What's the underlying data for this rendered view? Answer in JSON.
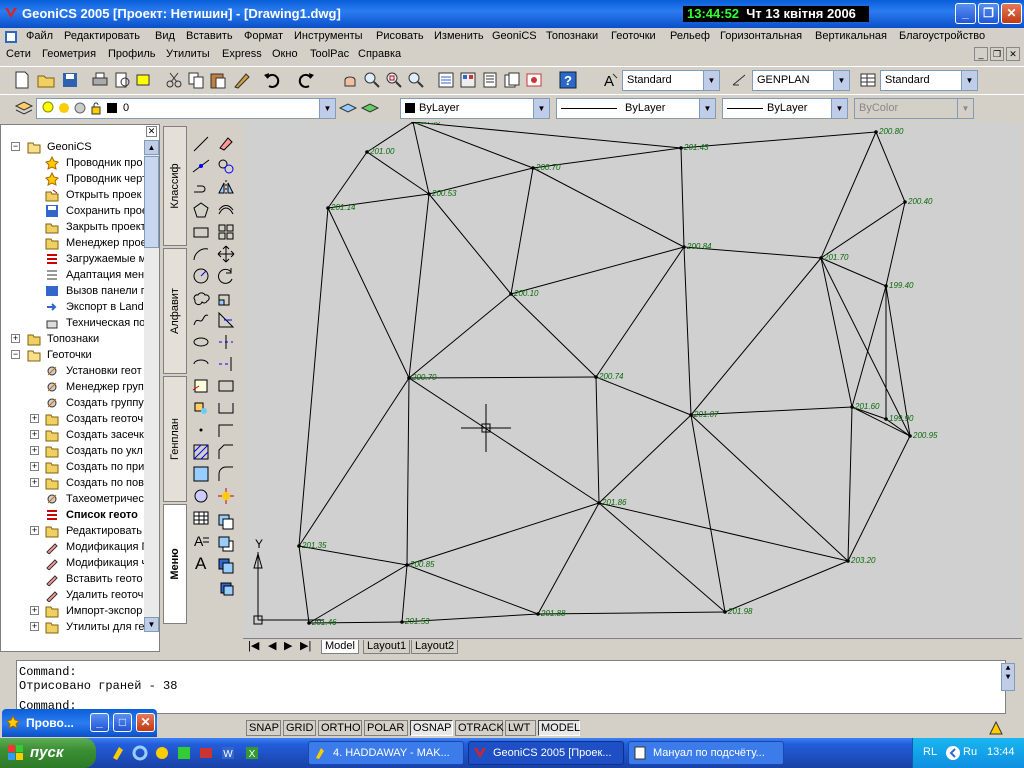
{
  "window": {
    "title": "GeoniCS 2005 [Проект: Нетишин] - [Drawing1.dwg]",
    "clock_time": "13:44:52",
    "clock_date": "Чт 13 квітня 2006",
    "btn_min": "_",
    "btn_max": "❐",
    "btn_close": "✕"
  },
  "menu1": [
    "Файл",
    "Редактировать",
    "Вид",
    "Вставить",
    "Формат",
    "Инструменты",
    "Рисовать",
    "Изменить",
    "GeoniCS",
    "Топознаки",
    "Геоточки",
    "Рельеф",
    "Горизонтальная",
    "Вертикальная",
    "Благоустройство"
  ],
  "menu2": [
    "Сети",
    "Геометрия",
    "Профиль",
    "Утилиты",
    "Express",
    "Окно",
    "ToolPac",
    "Справка"
  ],
  "mdi": {
    "min": "_",
    "restore": "❐",
    "close": "✕"
  },
  "toolbar": {
    "text_style": "Standard",
    "dim_style": "GENPLAN",
    "table_style": "Standard",
    "layer": "0",
    "color": "ByLayer",
    "linetype": "ByLayer",
    "lineweight": "ByLayer",
    "plotstyle": "ByColor"
  },
  "tree": [
    {
      "label": "GeoniCS",
      "level": 0,
      "exp": "−",
      "icon": "folder-open"
    },
    {
      "label": "Проводник про",
      "level": 2,
      "icon": "star"
    },
    {
      "label": "Проводник черт",
      "level": 2,
      "icon": "star"
    },
    {
      "label": "Открыть проек",
      "level": 2,
      "icon": "open"
    },
    {
      "label": "Сохранить прое",
      "level": 2,
      "icon": "save"
    },
    {
      "label": "Закрыть проект",
      "level": 2,
      "icon": "close-doc"
    },
    {
      "label": "Менеджер прое",
      "level": 2,
      "icon": "folder"
    },
    {
      "label": "Загружаемые м",
      "level": 2,
      "icon": "list"
    },
    {
      "label": "Адаптация мен",
      "level": 2,
      "icon": "menu"
    },
    {
      "label": "Вызов панели г",
      "level": 2,
      "icon": "panel"
    },
    {
      "label": "Экспорт в Land",
      "level": 2,
      "icon": "export"
    },
    {
      "label": "Техническая по",
      "level": 2,
      "icon": "phone"
    },
    {
      "label": "Топознаки",
      "level": 0,
      "exp": "+",
      "icon": "folder"
    },
    {
      "label": "Геоточки",
      "level": 0,
      "exp": "−",
      "icon": "folder-open"
    },
    {
      "label": "Установки геот",
      "level": 2,
      "icon": "settings"
    },
    {
      "label": "Менеджер груп",
      "level": 2,
      "icon": "settings"
    },
    {
      "label": "Создать группу",
      "level": 2,
      "icon": "settings"
    },
    {
      "label": "Создать геоточ",
      "level": 1,
      "exp": "+",
      "icon": "folder"
    },
    {
      "label": "Создать засечк",
      "level": 1,
      "exp": "+",
      "icon": "folder"
    },
    {
      "label": "Создать по укл",
      "level": 1,
      "exp": "+",
      "icon": "folder"
    },
    {
      "label": "Создать по при",
      "level": 1,
      "exp": "+",
      "icon": "folder"
    },
    {
      "label": "Создать по пов",
      "level": 1,
      "exp": "+",
      "icon": "folder"
    },
    {
      "label": "Тахеометричес",
      "level": 2,
      "icon": "settings"
    },
    {
      "label": "Список геото",
      "level": 2,
      "icon": "list",
      "bold": true
    },
    {
      "label": "Редактировать",
      "level": 1,
      "exp": "+",
      "icon": "folder"
    },
    {
      "label": "Модификация Г",
      "level": 2,
      "icon": "edit"
    },
    {
      "label": "Модификация ч",
      "level": 2,
      "icon": "edit"
    },
    {
      "label": "Вставить геото",
      "level": 2,
      "icon": "edit"
    },
    {
      "label": "Удалить геоточ",
      "level": 2,
      "icon": "edit"
    },
    {
      "label": "Импорт-экспор",
      "level": 1,
      "exp": "+",
      "icon": "folder"
    },
    {
      "label": "Утилиты для ге",
      "level": 1,
      "exp": "+",
      "icon": "folder"
    }
  ],
  "vtabs": [
    "Классиф",
    "Алфавит",
    "Генплан",
    "Меню"
  ],
  "points": [
    {
      "label": "201.00",
      "x": 0
    },
    {
      "label": "201.43",
      "x": 1
    },
    {
      "label": "200.80",
      "x": 2
    },
    {
      "label": "200.70",
      "x": 3
    },
    {
      "label": "200.53",
      "x": 4
    },
    {
      "label": "201.14",
      "x": 5
    },
    {
      "label": "200.40",
      "x": 6
    },
    {
      "label": "200.84",
      "x": 7
    },
    {
      "label": "201.70",
      "x": 8
    },
    {
      "label": "199.40",
      "x": 9
    },
    {
      "label": "200.10",
      "x": 10
    },
    {
      "label": "200.70",
      "x": 11
    },
    {
      "label": "200.74",
      "x": 12
    },
    {
      "label": "201.07",
      "x": 13
    },
    {
      "label": "201.60",
      "x": 14
    },
    {
      "label": "199.90",
      "x": 15
    },
    {
      "label": "200.95",
      "x": 16
    },
    {
      "label": "201.86",
      "x": 17
    },
    {
      "label": "201.35",
      "x": 18
    },
    {
      "label": "200.85",
      "x": 19
    },
    {
      "label": "203.20",
      "x": 20
    },
    {
      "label": "201.46",
      "x": 21
    },
    {
      "label": "201.53",
      "x": 22
    },
    {
      "label": "201.88",
      "x": 23
    },
    {
      "label": "201.98",
      "x": 24
    },
    {
      "label": "200.90",
      "x": 25
    }
  ],
  "ucs": {
    "y_label": "Y"
  },
  "layout_tabs": [
    "Model",
    "Layout1",
    "Layout2"
  ],
  "command": {
    "line1": "Command:",
    "line2": "Отрисовано граней - 38",
    "line3": "Command:"
  },
  "status_buttons": [
    "SNAP",
    "GRID",
    "ORTHO",
    "POLAR",
    "OSNAP",
    "OTRACK",
    "LWT",
    "MODEL"
  ],
  "status_on": [
    "OSNAP",
    "MODEL"
  ],
  "miniwin": {
    "title": "Прово...",
    "min": "_",
    "max": "□",
    "close": "✕"
  },
  "taskbar": {
    "start": "пуск",
    "items": [
      "4. HADDAWAY - MAK...",
      "GeoniCS 2005 [Проек...",
      "Мануал по подсчёту..."
    ],
    "lang": "RL",
    "lang2": "Ru",
    "time": "13:44"
  }
}
